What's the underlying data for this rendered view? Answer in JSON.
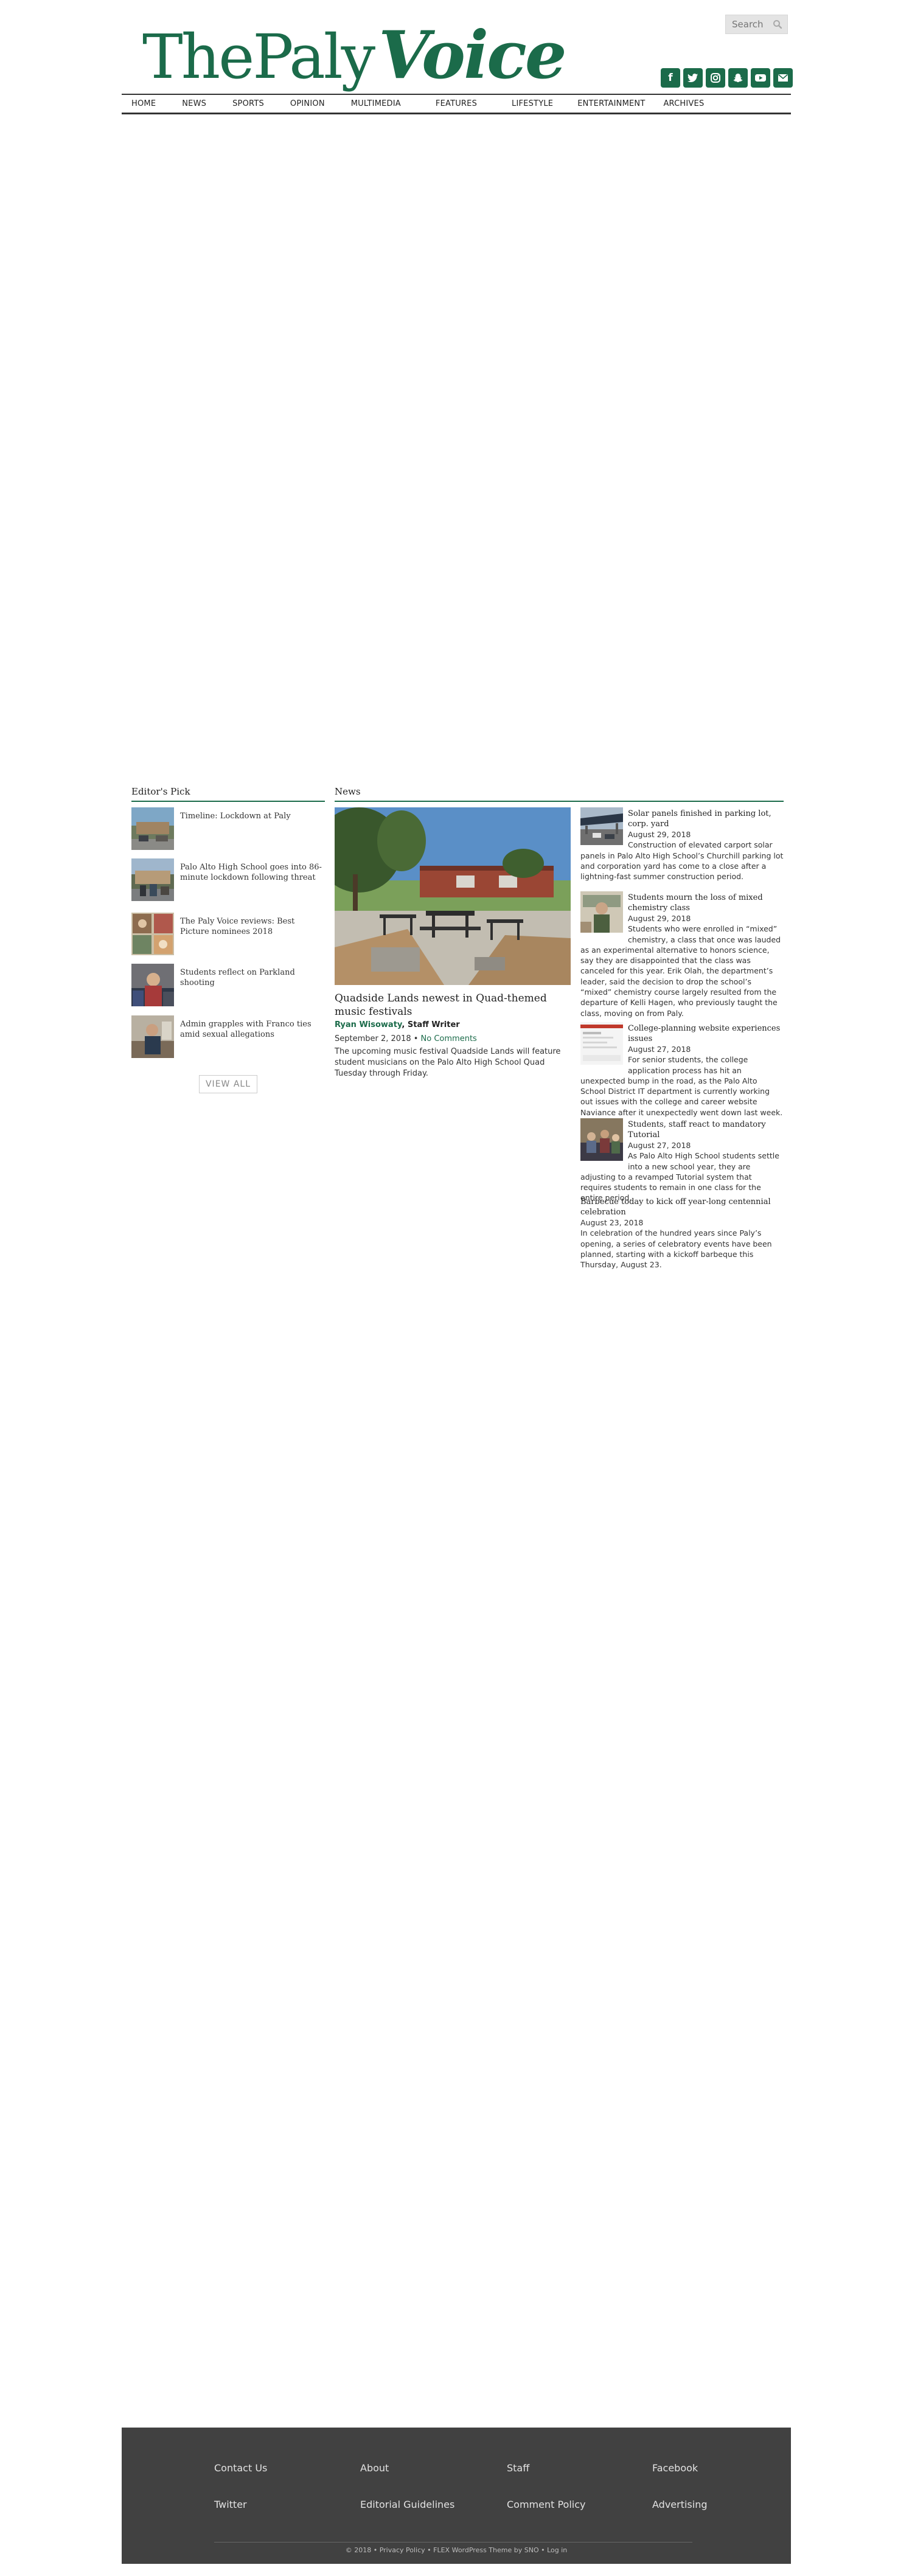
{
  "masthead": {
    "part1": "ThePaly",
    "part2": "Voice"
  },
  "search": {
    "placeholder": "Search"
  },
  "social_icons": [
    "facebook-icon",
    "twitter-icon",
    "instagram-icon",
    "snapchat-icon",
    "youtube-icon",
    "email-icon"
  ],
  "nav": [
    "HOME",
    "NEWS",
    "SPORTS",
    "OPINION",
    "MULTIMEDIA",
    "FEATURES",
    "LIFESTYLE",
    "ENTERTAINMENT",
    "ARCHIVES"
  ],
  "editors_pick": {
    "title": "Editor's Pick",
    "items": [
      {
        "title": "Timeline: Lockdown at Paly"
      },
      {
        "title": "Palo Alto High School goes into 86-minute lockdown following threat"
      },
      {
        "title": "The Paly Voice reviews: Best Picture nominees 2018"
      },
      {
        "title": "Students reflect on Parkland shooting"
      },
      {
        "title": "Admin grapples with Franco ties amid sexual allegations"
      }
    ],
    "view_all": "VIEW ALL"
  },
  "news": {
    "title": "News",
    "featured": {
      "title": "Quadside Lands newest in Quad-themed music festivals",
      "author": "Ryan Wisowaty",
      "role": ", Staff Writer",
      "date": "September 2, 2018",
      "separator": " • ",
      "comments": "No Comments",
      "description": "The upcoming music festival Quadside Lands will feature student musicians on the Palo Alto High School Quad Tuesday through Friday."
    },
    "items": [
      {
        "title": "Solar panels finished in parking lot, corp. yard",
        "date": "August 29, 2018",
        "description": "Construction of elevated carport solar panels in Palo Alto High School’s Churchill parking lot and corporation yard has come to a close after a lightning-fast summer construction period."
      },
      {
        "title": "Students mourn the loss of mixed chemistry class",
        "date": "August 29, 2018",
        "description": "Students who were enrolled in “mixed” chemistry, a class that once was lauded as an experimental alternative to honors science, say they are disappointed that the class was canceled for this year. Erik Olah, the department’s leader, said the decision to drop the school’s “mixed” chemistry course largely resulted from the departure of Kelli Hagen, who previously taught the class, moving on from Paly."
      },
      {
        "title": "College-planning website experiences issues",
        "date": "August 27, 2018",
        "description": "For senior students, the college application process has hit an unexpected bump in the road, as the Palo Alto School District IT department is currently working out issues with the college and career website Naviance after it unexpectedly went down last week."
      },
      {
        "title": "Students, staff react to mandatory Tutorial",
        "date": "August 27, 2018",
        "description": "As Palo Alto High School students settle into a new school year, they are adjusting to a revamped Tutorial system that requires students to remain in one class for the entire period."
      },
      {
        "title": "Barbecue today to kick off year-long centennial celebration",
        "date": "August 23, 2018",
        "description": "In celebration of the hundred years since Paly’s opening, a series of celebratory events have been planned, starting with a kickoff barbeque this Thursday, August 23."
      }
    ]
  },
  "footer": {
    "links": [
      "Contact Us",
      "About",
      "Staff",
      "Facebook",
      "Twitter",
      "Editorial Guidelines",
      "Comment Policy",
      "Advertising"
    ],
    "copyright": "© 2018 • Privacy Policy • FLEX WordPress Theme by SNO • Log in"
  }
}
